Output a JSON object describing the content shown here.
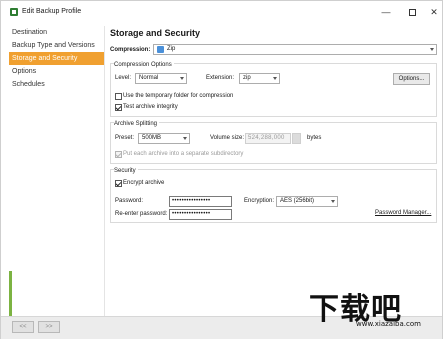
{
  "window": {
    "title": "Edit Backup Profile",
    "controls": {
      "minimize": "—",
      "close": "✕"
    }
  },
  "sidebar": {
    "items": [
      {
        "label": "Destination",
        "active": false
      },
      {
        "label": "Backup Type and Versions",
        "active": false
      },
      {
        "label": "Storage and Security",
        "active": true
      },
      {
        "label": "Options",
        "active": false
      },
      {
        "label": "Schedules",
        "active": false
      }
    ]
  },
  "bottom_nav": {
    "prev_label": "<<",
    "next_label": ">>"
  },
  "main": {
    "title": "Storage and Security",
    "compression": {
      "label": "Compression:",
      "value": "Zip"
    },
    "compression_options": {
      "title": "Compression Options",
      "level_label": "Level:",
      "level_value": "Normal",
      "extension_label": "Extension:",
      "extension_value": "zip",
      "options_button": "Options...",
      "temp_folder_label": "Use the temporary folder for compression",
      "temp_folder_checked": false,
      "test_integrity_label": "Test archive integrity",
      "test_integrity_checked": true
    },
    "archive_splitting": {
      "title": "Archive Splitting",
      "preset_label": "Preset:",
      "preset_value": "500MB",
      "volume_label": "Volume size:",
      "volume_value": "524,288,000",
      "volume_unit": "bytes",
      "subdir_label": "Put each archive into a separate subdirectory",
      "subdir_checked": true
    },
    "security": {
      "title": "Security",
      "encrypt_label": "Encrypt archive",
      "encrypt_checked": true,
      "password_label": "Password:",
      "password_value": "••••••••••••••••",
      "reenter_label": "Re-enter password:",
      "reenter_value": "••••••••••••••••",
      "encryption_label": "Encryption:",
      "encryption_value": "AES (256bit)",
      "password_manager_link": "Password Manager..."
    }
  },
  "watermark": {
    "main": "下载吧",
    "sub": "www.xiazaiba.com"
  },
  "colors": {
    "accent": "#f0a030",
    "sidebar_strip": "#7cb342"
  }
}
